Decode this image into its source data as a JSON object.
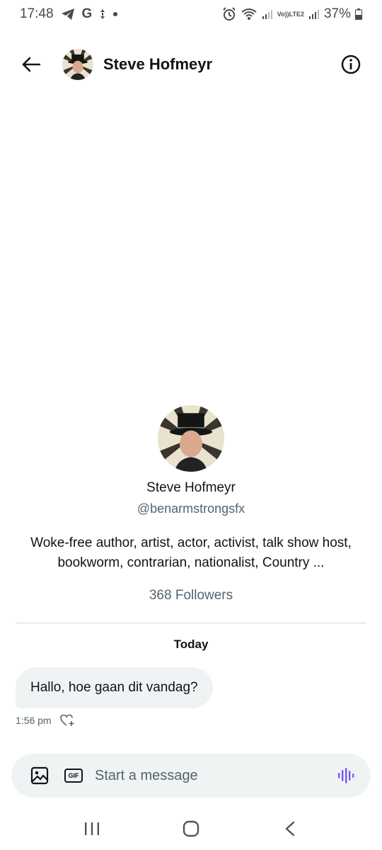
{
  "status_bar": {
    "time": "17:48",
    "google_letter": "G",
    "volte_label": "Vo))",
    "lte_label": "LTE2",
    "battery_percent": "37%"
  },
  "header": {
    "title": "Steve Hofmeyr"
  },
  "profile": {
    "name": "Steve Hofmeyr",
    "handle": "@benarmstrongsfx",
    "bio": "Woke-free author, artist, actor, activist, talk show host, bookworm, contrarian, nationalist, Country ...",
    "followers": "368 Followers"
  },
  "conversation": {
    "date_separator": "Today",
    "messages": [
      {
        "text": "Hallo, hoe gaan dit vandag?",
        "time": "1:56 pm"
      }
    ]
  },
  "composer": {
    "placeholder": "Start a message",
    "gif_label": "GIF"
  },
  "colors": {
    "accent": "#7856ff",
    "bubble_bg": "#eff3f4",
    "secondary_text": "#536471"
  }
}
